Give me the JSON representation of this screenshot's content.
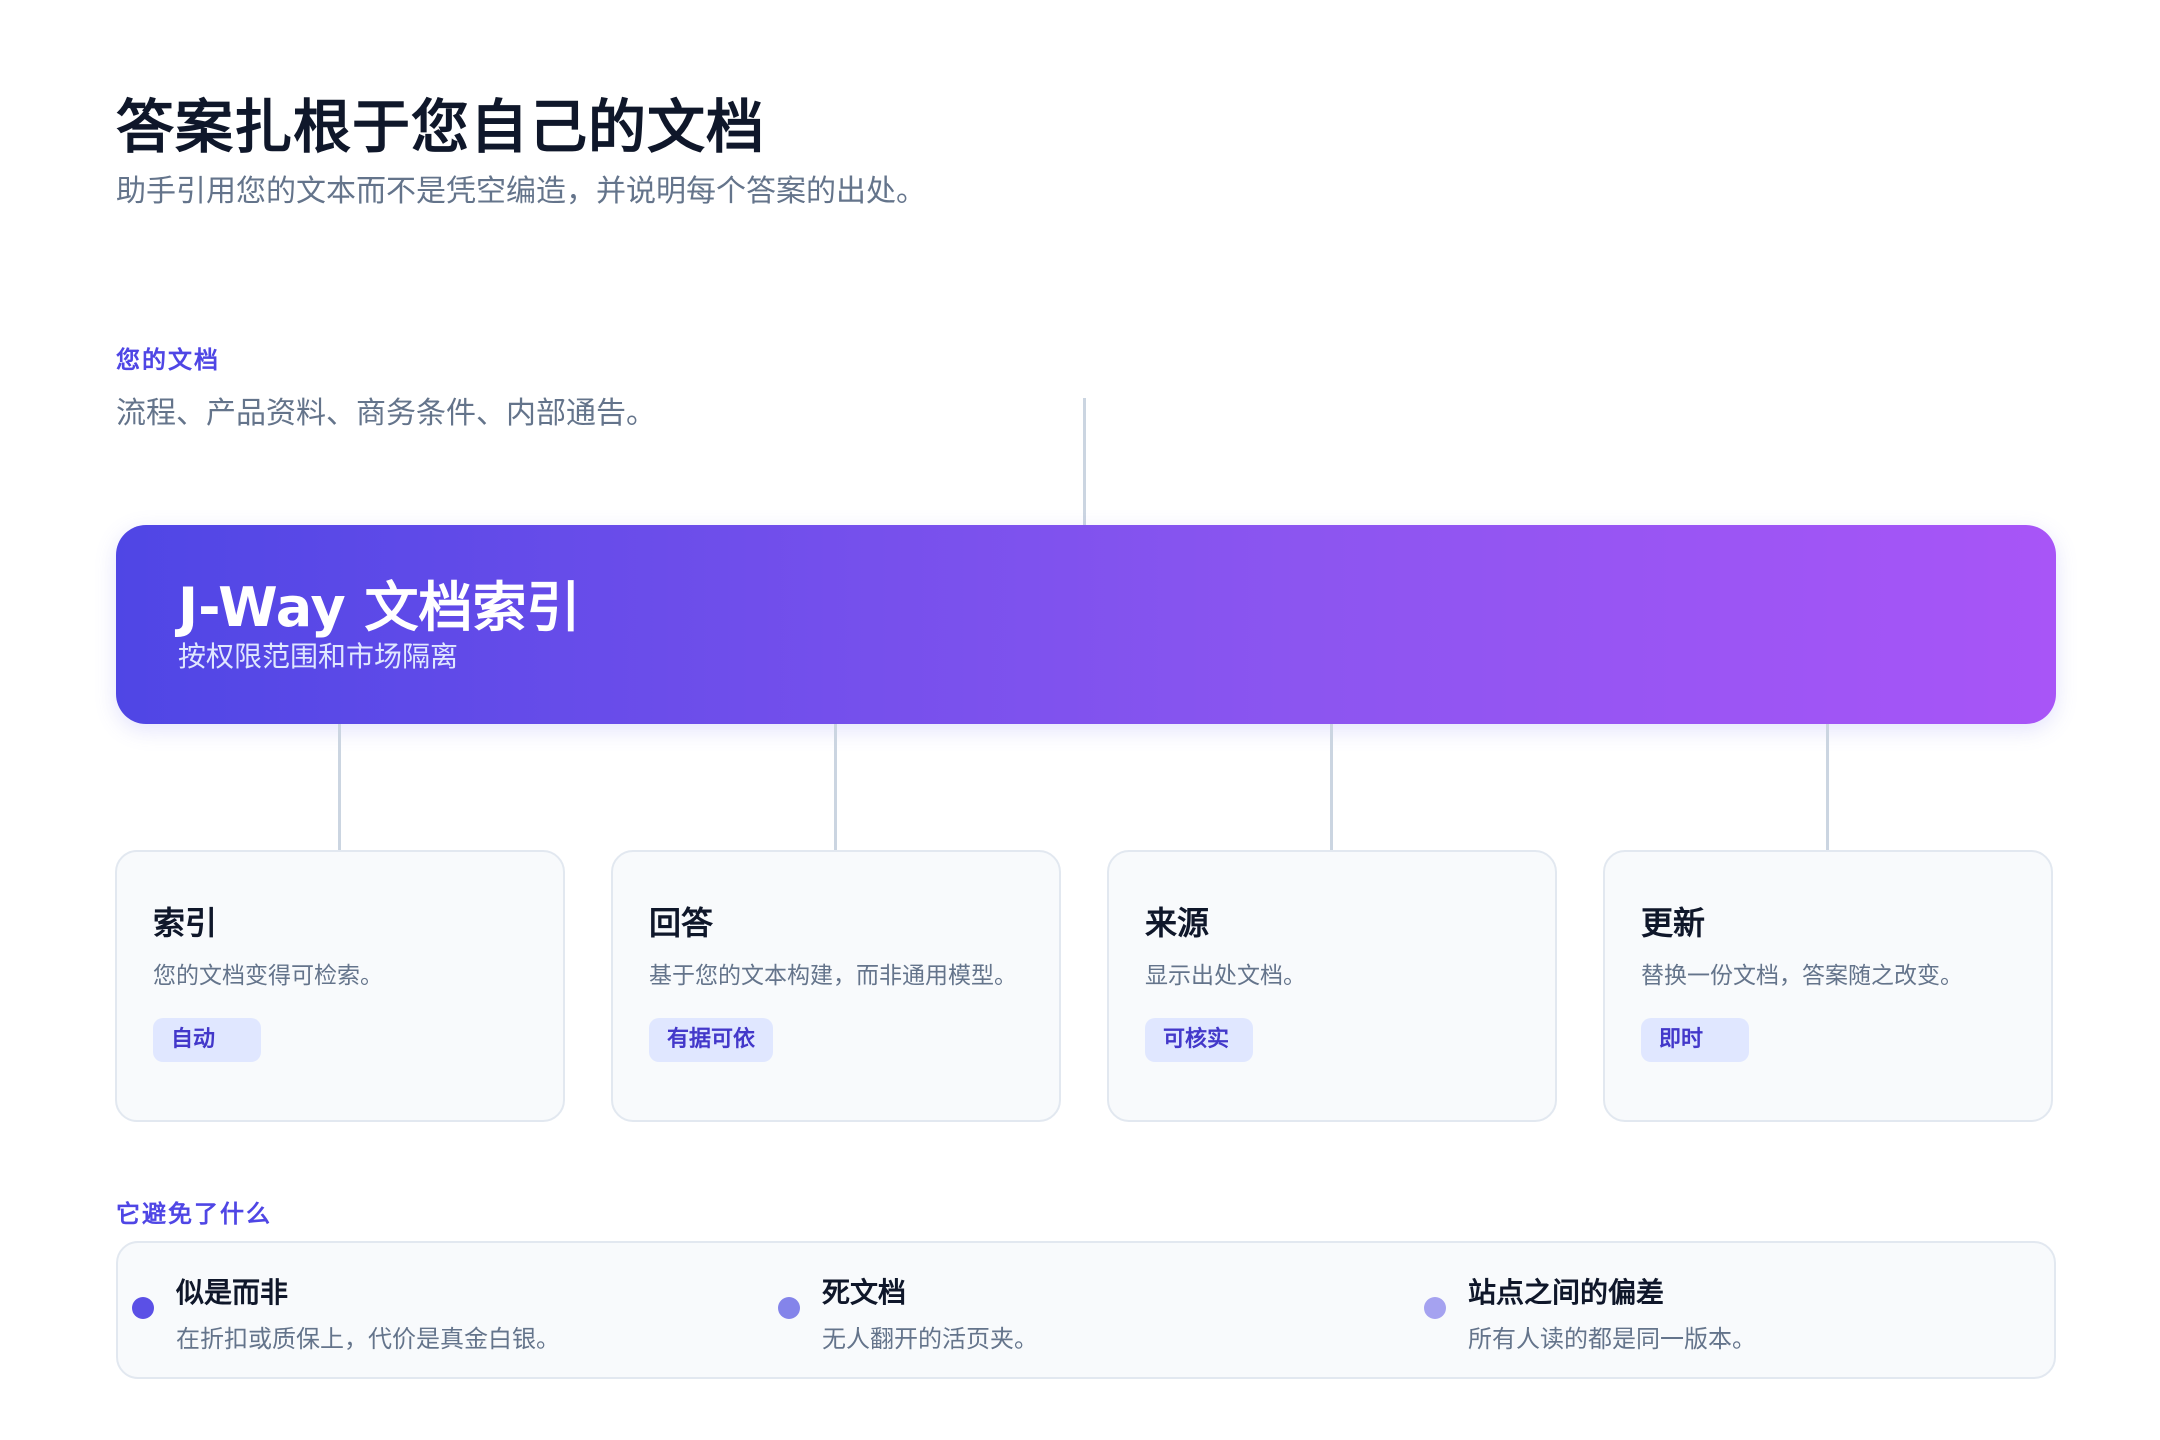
{
  "header": {
    "title": "答案扎根于您自己的文档",
    "subtitle": "助手引用您的文本而不是凭空编造，并说明每个答案的出处。"
  },
  "docs": {
    "label": "您的文档",
    "description": "流程、产品资料、商务条件、内部通告。"
  },
  "hero": {
    "title": "J-Way 文档索引",
    "subtitle": "按权限范围和市场隔离",
    "gradient_start": "#4f46e5",
    "gradient_end": "#a855f7"
  },
  "cards": [
    {
      "title": "索引",
      "description": "您的文档变得可检索。",
      "badge": "自动"
    },
    {
      "title": "回答",
      "description": "基于您的文本构建，而非通用模型。",
      "badge": "有据可依"
    },
    {
      "title": "来源",
      "description": "显示出处文档。",
      "badge": "可核实"
    },
    {
      "title": "更新",
      "description": "替换一份文档，答案随之改变。",
      "badge": "即时"
    }
  ],
  "avoid": {
    "label": "它避免了什么",
    "items": [
      {
        "title": "似是而非",
        "description": "在折扣或质保上，代价是真金白银。",
        "dot_color": "#5b50e6"
      },
      {
        "title": "死文档",
        "description": "无人翻开的活页夹。",
        "dot_color": "#8484ea"
      },
      {
        "title": "站点之间的偏差",
        "description": "所有人读的都是同一版本。",
        "dot_color": "#a5a2f0"
      }
    ]
  },
  "colors": {
    "accent": "#4f46e5",
    "connector": "#cbd5e1",
    "badge_bg": "#e0e7ff",
    "badge_text": "#4338ca"
  }
}
